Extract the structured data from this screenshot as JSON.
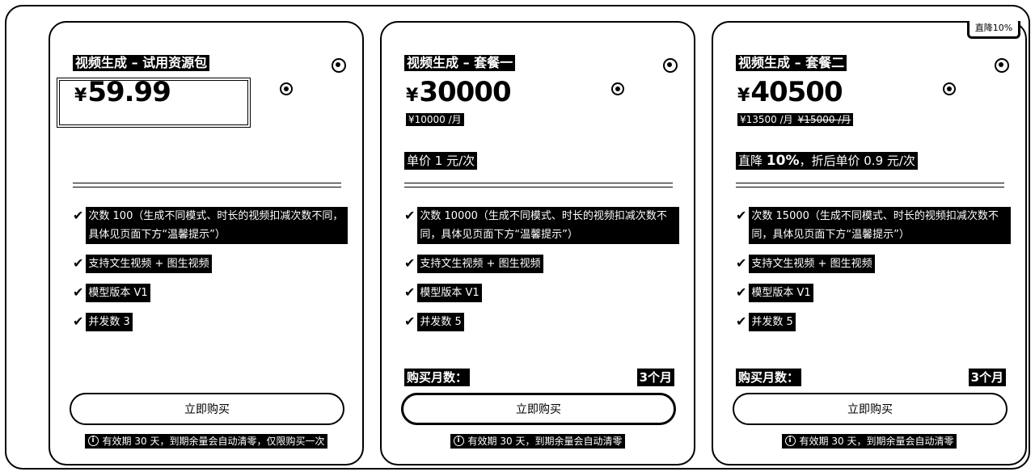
{
  "top_tag": "直降10%",
  "cards": [
    {
      "title": "视频生成 – 试用资源包",
      "currency": "¥",
      "price": "59.99",
      "monthly": "",
      "original": "",
      "promo_prefix": "",
      "promo_bold": "",
      "promo_suffix": "",
      "features": [
        "次数 100（生成不同模式、时长的视频扣减次数不同，具体见页面下方“温馨提示”）",
        "支持文生视频 + 图生视频",
        "模型版本 V1",
        "并发数 3"
      ],
      "months_label": "",
      "months_value": "",
      "buy_label": "立即购买",
      "note": "有效期 30 天，到期余量会自动清零，仅限购买一次"
    },
    {
      "title": "视频生成 – 套餐一",
      "currency": "¥",
      "price": "30000",
      "monthly": "¥10000 /月",
      "original": "",
      "promo_prefix": "单价 1 元/次",
      "promo_bold": "",
      "promo_suffix": "",
      "features": [
        "次数 10000（生成不同模式、时长的视频扣减次数不同，具体见页面下方“温馨提示”）",
        "支持文生视频 + 图生视频",
        "模型版本 V1",
        "并发数 5"
      ],
      "months_label": "购买月数：",
      "months_value": "3个月",
      "buy_label": "立即购买",
      "note": "有效期 30 天，到期余量会自动清零"
    },
    {
      "title": "视频生成 – 套餐二",
      "currency": "¥",
      "price": "40500",
      "monthly": "¥13500 /月",
      "original": "¥15000 /月",
      "promo_prefix": "直降 ",
      "promo_bold": "10%",
      "promo_suffix": "，折后单价 0.9 元/次",
      "features": [
        "次数 15000（生成不同模式、时长的视频扣减次数不同，具体见页面下方“温馨提示”）",
        "支持文生视频 + 图生视频",
        "模型版本 V1",
        "并发数 5"
      ],
      "months_label": "购买月数：",
      "months_value": "3个月",
      "buy_label": "立即购买",
      "note": "有效期 30 天，到期余量会自动清零"
    }
  ],
  "icons": {
    "check": "check-icon",
    "info": "info-icon",
    "sparkle": "sparkle-icon"
  }
}
